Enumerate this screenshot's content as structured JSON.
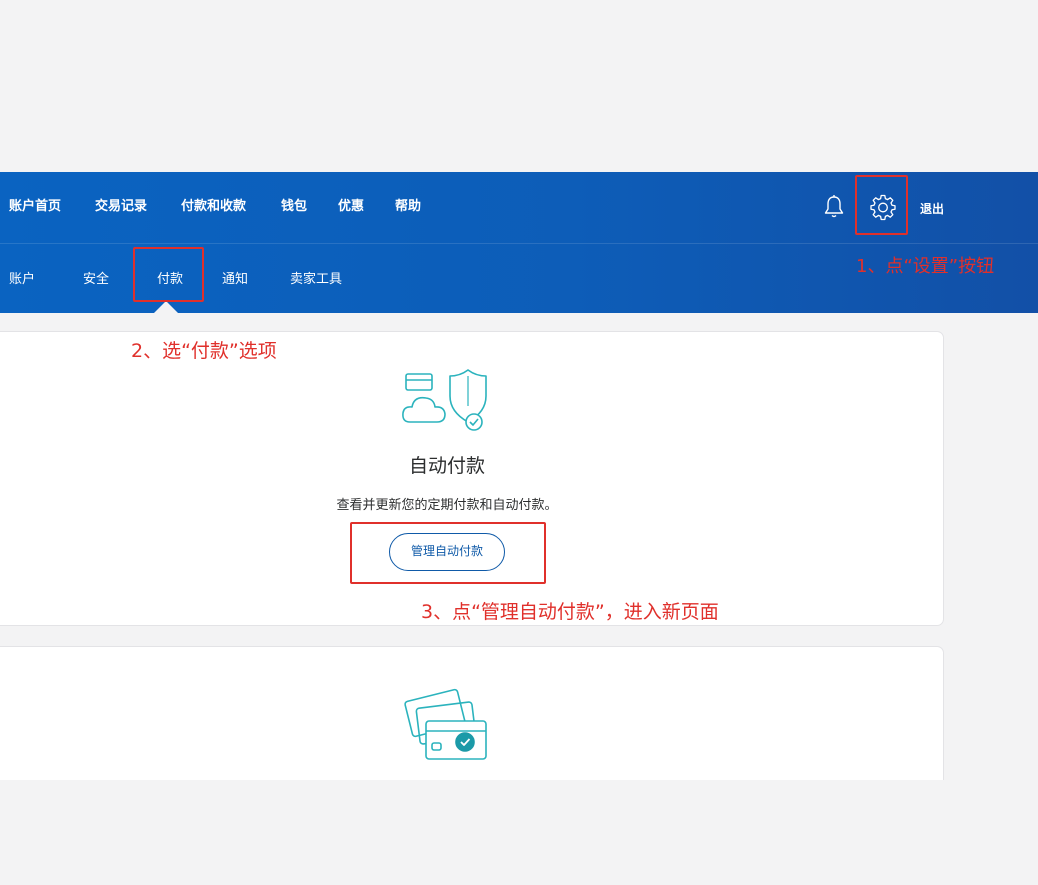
{
  "header": {
    "top_nav": [
      {
        "label": "账户首页"
      },
      {
        "label": "交易记录"
      },
      {
        "label": "付款和收款"
      },
      {
        "label": "钱包"
      },
      {
        "label": "优惠"
      },
      {
        "label": "帮助"
      }
    ],
    "logout_label": "退出",
    "bell_icon": "bell-icon",
    "settings_icon": "gear-icon",
    "sub_nav": [
      {
        "label": "账户"
      },
      {
        "label": "安全"
      },
      {
        "label": "付款",
        "selected": true
      },
      {
        "label": "通知"
      },
      {
        "label": "卖家工具"
      }
    ]
  },
  "auto_pay_card": {
    "icon": "cloud-shield-icon",
    "title": "自动付款",
    "description": "查看并更新您的定期付款和自动付款。",
    "button_label": "管理自动付款"
  },
  "cards_section": {
    "icon": "credit-cards-icon"
  },
  "annotations": {
    "step1": "1、点“设置”按钮",
    "step2": "2、选“付款”选项",
    "step3": "3、点“管理自动付款”，进入新页面"
  },
  "colors": {
    "header_blue": "#0a63c1",
    "accent_red": "#e0302b",
    "button_blue": "#0f5aa8",
    "icon_teal": "#2bb3bd"
  }
}
